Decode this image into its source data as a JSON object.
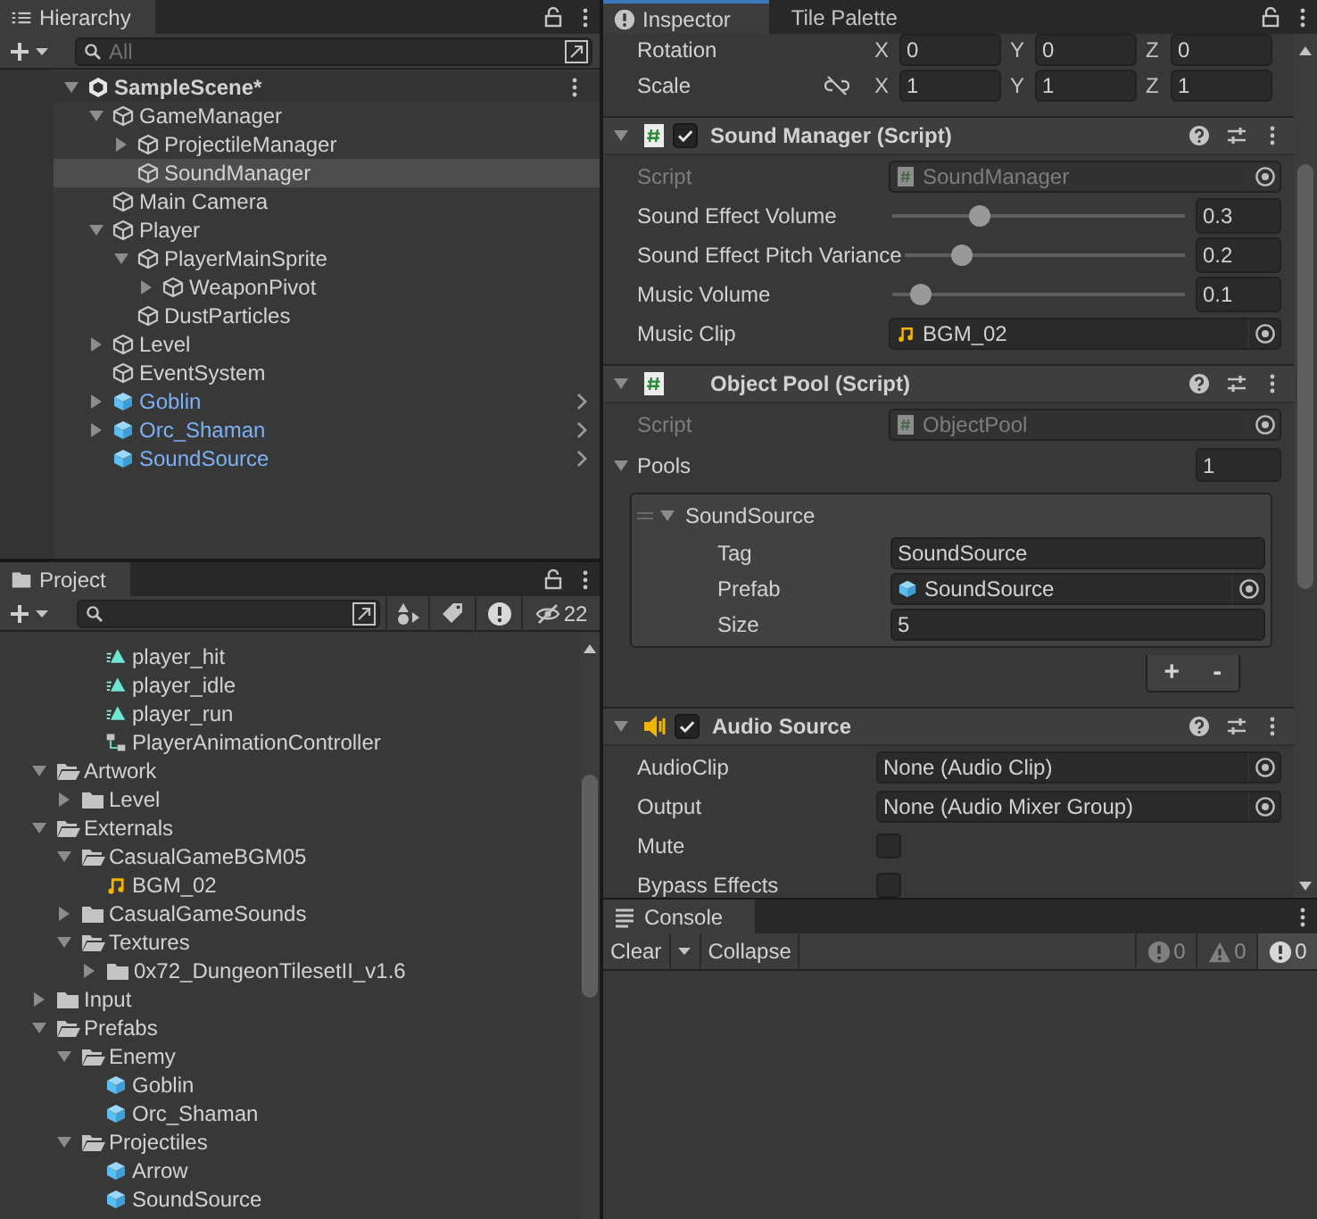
{
  "hierarchy": {
    "title": "Hierarchy",
    "search_placeholder": "All",
    "items": [
      {
        "label": "SampleScene*",
        "kind": "scene",
        "expanded": true,
        "selected": false,
        "children": [
          {
            "label": "GameManager",
            "kind": "gameobject",
            "expanded": true,
            "selected": false,
            "children": [
              {
                "label": "ProjectileManager",
                "kind": "gameobject",
                "expanded": false,
                "selected": false
              },
              {
                "label": "SoundManager",
                "kind": "gameobject",
                "selected": true
              }
            ]
          },
          {
            "label": "Main Camera",
            "kind": "gameobject",
            "selected": false
          },
          {
            "label": "Player",
            "kind": "gameobject",
            "expanded": true,
            "selected": false,
            "children": [
              {
                "label": "PlayerMainSprite",
                "kind": "gameobject",
                "expanded": true,
                "selected": false,
                "children": [
                  {
                    "label": "WeaponPivot",
                    "kind": "gameobject",
                    "expanded": false,
                    "selected": false
                  }
                ]
              },
              {
                "label": "DustParticles",
                "kind": "gameobject",
                "selected": false
              }
            ]
          },
          {
            "label": "Level",
            "kind": "gameobject",
            "expanded": false,
            "selected": false
          },
          {
            "label": "EventSystem",
            "kind": "gameobject",
            "selected": false
          },
          {
            "label": "Goblin",
            "kind": "prefab",
            "expanded": false,
            "selected": false
          },
          {
            "label": "Orc_Shaman",
            "kind": "prefab",
            "expanded": false,
            "selected": false
          },
          {
            "label": "SoundSource",
            "kind": "prefab",
            "selected": false
          }
        ]
      }
    ]
  },
  "project": {
    "title": "Project",
    "hidden_count": "22",
    "scrolled_branch": [
      {
        "label": "player_hit",
        "kind": "animation",
        "selected": false
      },
      {
        "label": "player_idle",
        "kind": "animation",
        "selected": false
      },
      {
        "label": "player_run",
        "kind": "animation",
        "selected": false
      },
      {
        "label": "PlayerAnimationController",
        "kind": "controller",
        "selected": false
      }
    ],
    "items": [
      {
        "label": "Artwork",
        "kind": "folder",
        "expanded": true,
        "selected": false,
        "children": [
          {
            "label": "Level",
            "kind": "folder",
            "expanded": false,
            "selected": false
          }
        ]
      },
      {
        "label": "Externals",
        "kind": "folder",
        "expanded": true,
        "selected": false,
        "children": [
          {
            "label": "CasualGameBGM05",
            "kind": "folder",
            "expanded": true,
            "selected": false,
            "children": [
              {
                "label": "BGM_02",
                "kind": "audio",
                "selected": false
              }
            ]
          },
          {
            "label": "CasualGameSounds",
            "kind": "folder",
            "expanded": false,
            "selected": false
          },
          {
            "label": "Textures",
            "kind": "folder",
            "expanded": true,
            "selected": false,
            "children": [
              {
                "label": "0x72_DungeonTilesetII_v1.6",
                "kind": "folder",
                "expanded": false,
                "selected": false
              }
            ]
          }
        ]
      },
      {
        "label": "Input",
        "kind": "folder",
        "expanded": false,
        "selected": false
      },
      {
        "label": "Prefabs",
        "kind": "folder",
        "expanded": true,
        "selected": false,
        "children": [
          {
            "label": "Enemy",
            "kind": "folder",
            "expanded": true,
            "selected": false,
            "children": [
              {
                "label": "Goblin",
                "kind": "prefab",
                "selected": false
              },
              {
                "label": "Orc_Shaman",
                "kind": "prefab",
                "selected": false
              }
            ]
          },
          {
            "label": "Projectiles",
            "kind": "folder",
            "expanded": true,
            "selected": false,
            "children": [
              {
                "label": "Arrow",
                "kind": "prefab",
                "selected": false
              },
              {
                "label": "SoundSource",
                "kind": "prefab",
                "selected": false
              }
            ]
          }
        ]
      }
    ]
  },
  "inspector": {
    "tabs": [
      {
        "label": "Inspector",
        "selected": true
      },
      {
        "label": "Tile Palette",
        "selected": false
      }
    ],
    "transform_rows": [
      {
        "label": "Rotation",
        "kind": "vector",
        "values": [
          {
            "axis": "X",
            "value": "0"
          },
          {
            "axis": "Y",
            "value": "0"
          },
          {
            "axis": "Z",
            "value": "0"
          }
        ]
      },
      {
        "label": "Scale",
        "kind": "vector_link",
        "values": [
          {
            "axis": "X",
            "value": "1"
          },
          {
            "axis": "Y",
            "value": "1"
          },
          {
            "axis": "Z",
            "value": "1"
          }
        ]
      }
    ],
    "components": [
      {
        "title": "Sound Manager (Script)",
        "kind": "script",
        "expanded": true,
        "enabled": true,
        "fields": [
          {
            "kind": "script_ref",
            "label": "Script",
            "value": "SoundManager"
          },
          {
            "kind": "slider",
            "label": "Sound Effect Volume",
            "level": 0.3,
            "value": "0.3"
          },
          {
            "kind": "slider",
            "label": "Sound Effect Pitch Variance",
            "level": 0.2,
            "value": "0.2"
          },
          {
            "kind": "slider",
            "label": "Music Volume",
            "level": 0.1,
            "value": "0.1"
          },
          {
            "kind": "audio_ref",
            "label": "Music Clip",
            "value": "BGM_02"
          }
        ]
      },
      {
        "title": "Object Pool (Script)",
        "kind": "script",
        "expanded": true,
        "fields": [
          {
            "kind": "script_ref",
            "label": "Script",
            "value": "ObjectPool"
          },
          {
            "kind": "list",
            "label": "Pools",
            "expanded": true,
            "count": "1",
            "elements": [
              {
                "label": "SoundSource",
                "expanded": true,
                "fields": [
                  {
                    "kind": "text",
                    "label": "Tag",
                    "value": "SoundSource"
                  },
                  {
                    "kind": "prefab_ref",
                    "label": "Prefab",
                    "value": "SoundSource"
                  },
                  {
                    "kind": "text",
                    "label": "Size",
                    "value": "5"
                  }
                ]
              }
            ],
            "add": "+",
            "remove": "-"
          }
        ]
      },
      {
        "title": "Audio Source",
        "kind": "audio",
        "expanded": true,
        "enabled": true,
        "fields": [
          {
            "kind": "object_ref",
            "label": "AudioClip",
            "value": "None (Audio Clip)"
          },
          {
            "kind": "object_ref",
            "label": "Output",
            "value": "None (Audio Mixer Group)"
          },
          {
            "kind": "checkbox",
            "label": "Mute",
            "checked": false
          },
          {
            "kind": "checkbox",
            "label": "Bypass Effects",
            "checked": false
          }
        ]
      }
    ]
  },
  "console": {
    "title": "Console",
    "clear": "Clear",
    "collapse": "Collapse",
    "counts": [
      {
        "kind": "info",
        "count": "0",
        "on": false
      },
      {
        "kind": "warning",
        "count": "0",
        "on": false
      },
      {
        "kind": "error",
        "count": "0",
        "on": true
      }
    ]
  }
}
